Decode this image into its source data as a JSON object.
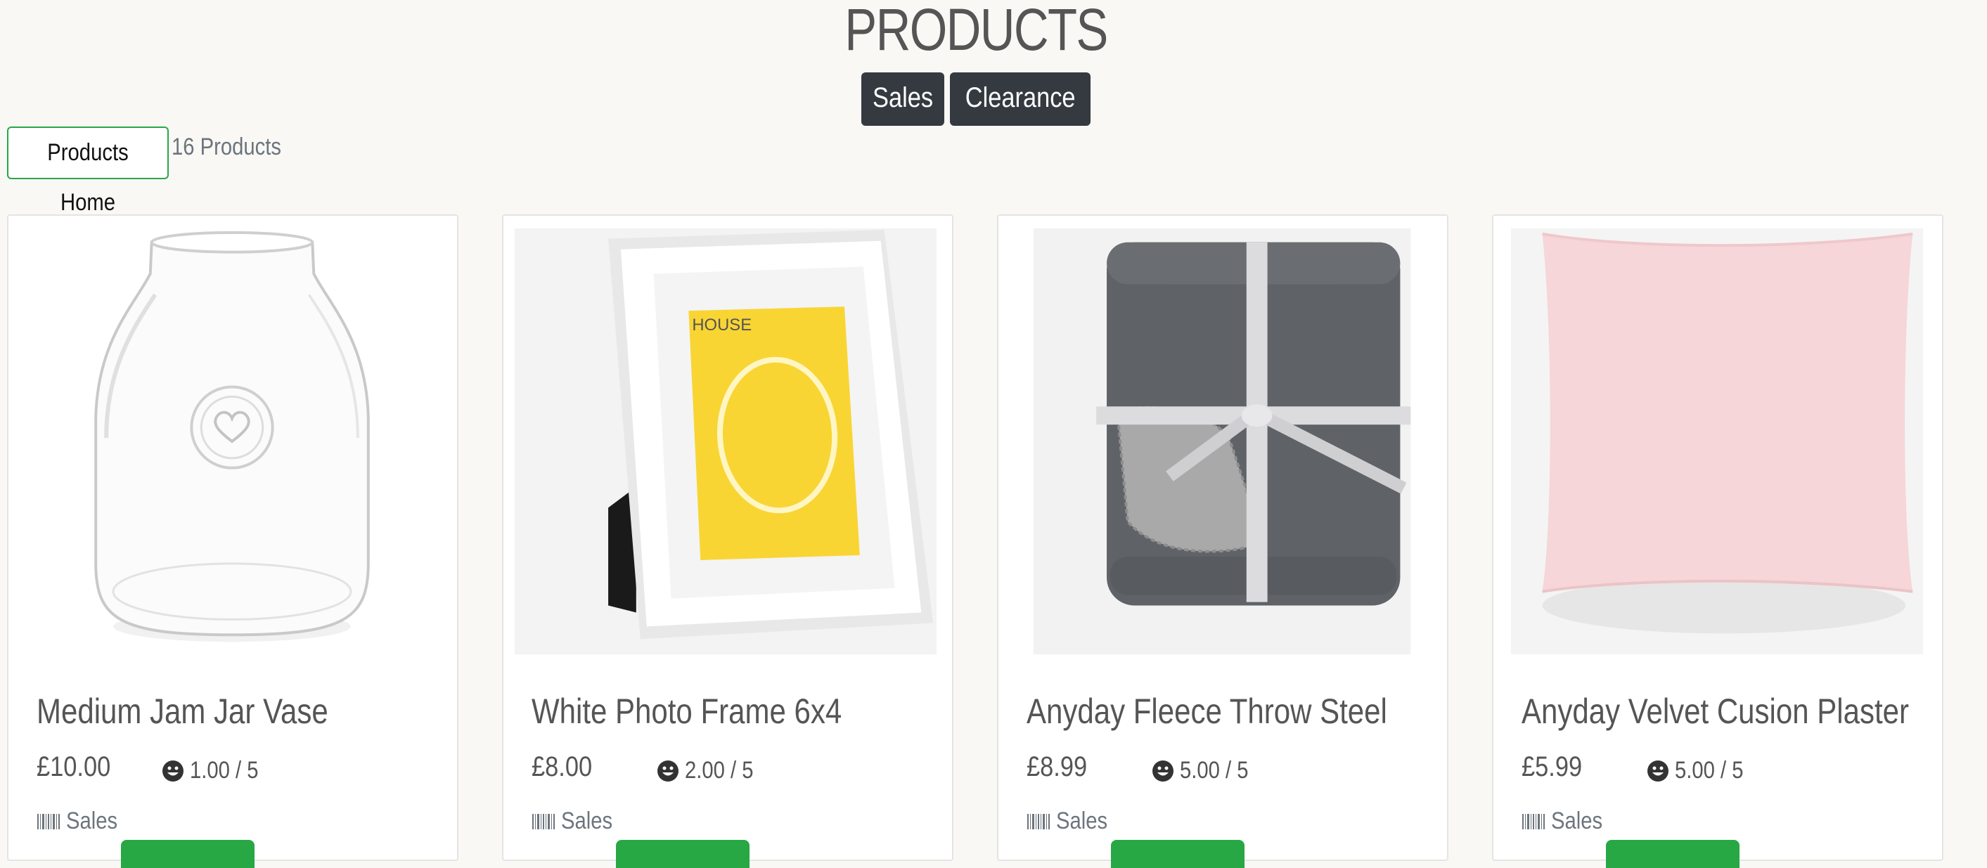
{
  "header": {
    "title": "PRODUCTS"
  },
  "categories": [
    {
      "label": "Sales"
    },
    {
      "label": "Clearance"
    }
  ],
  "toolbar": {
    "home_label": "Products Home",
    "count_label": "16 Products"
  },
  "colors": {
    "background": "#f9f8f5",
    "accent": "#28a745",
    "dark_button": "#343a40",
    "muted": "#6c757d"
  },
  "products": [
    {
      "name": "Medium Jam Jar Vase",
      "price": "£10.00",
      "rating": "1.00 / 5",
      "category": "Sales",
      "rating_icon": "smile-icon",
      "category_icon": "barcode-icon",
      "image": "glass-vase"
    },
    {
      "name": "White Photo Frame 6x4",
      "price": "£8.00",
      "rating": "2.00 / 5",
      "category": "Sales",
      "rating_icon": "smile-icon",
      "category_icon": "barcode-icon",
      "image": "white-photo-frame",
      "image_text": "HOUSE"
    },
    {
      "name": "Anyday Fleece Throw Steel",
      "price": "£8.99",
      "rating": "5.00 / 5",
      "category": "Sales",
      "rating_icon": "smile-icon",
      "category_icon": "barcode-icon",
      "image": "folded-grey-fleece-throw"
    },
    {
      "name": "Anyday Velvet Cusion Plaster",
      "price": "£5.99",
      "rating": "5.00 / 5",
      "category": "Sales",
      "rating_icon": "smile-icon",
      "category_icon": "barcode-icon",
      "image": "pink-velvet-cushion"
    }
  ]
}
